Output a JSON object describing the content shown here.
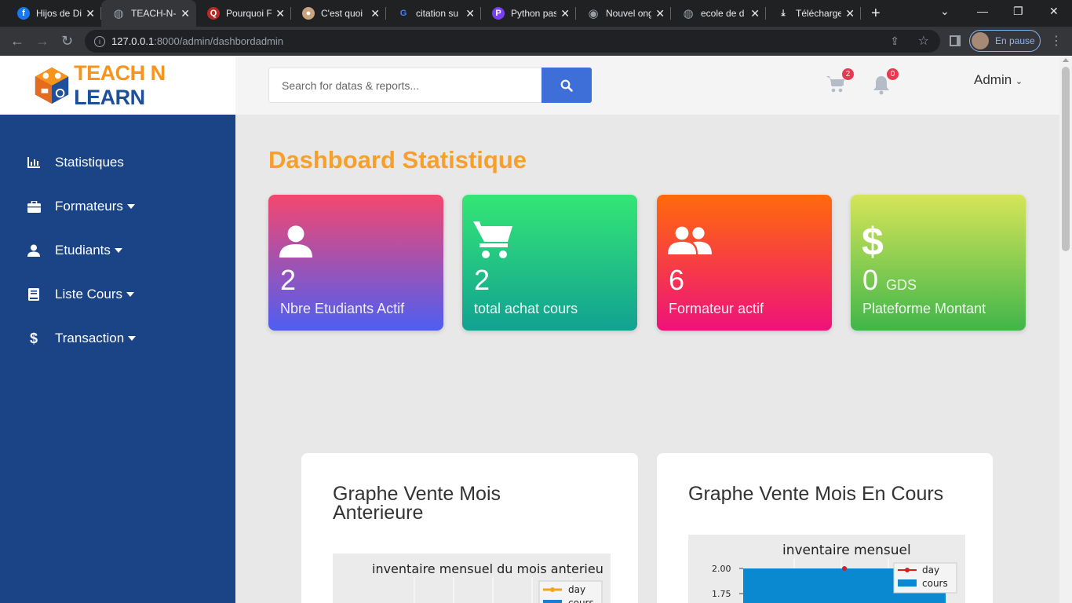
{
  "browser": {
    "tabs": [
      {
        "title": "Hijos de Di",
        "icon": "facebook-icon",
        "color": "#1877f2"
      },
      {
        "title": "TEACH-N-L",
        "icon": "globe-icon",
        "color": "#9aa0a6",
        "active": true
      },
      {
        "title": "Pourquoi F",
        "icon": "quora-icon",
        "color": "#b92b27"
      },
      {
        "title": "C'est quoi",
        "icon": "site-icon",
        "color": "#c9a27e"
      },
      {
        "title": "citation su",
        "icon": "google-icon",
        "color": "#ffffff"
      },
      {
        "title": "Python pas",
        "icon": "pycharm-icon",
        "color": "#7b3ff2"
      },
      {
        "title": "Nouvel ong",
        "icon": "chrome-icon",
        "color": "#9aa0a6"
      },
      {
        "title": "ecole de d",
        "icon": "globe-icon",
        "color": "#9aa0a6"
      },
      {
        "title": "Télécharge",
        "icon": "download-icon",
        "color": "#e8eaed"
      }
    ],
    "url_host": "127.0.0.1",
    "url_rest": ":8000/admin/dashbordadmin",
    "profile_label": "En pause"
  },
  "header": {
    "logo": {
      "part1": "TEACH N ",
      "part2": "LEARN"
    },
    "search_placeholder": "Search for datas & reports...",
    "cart_count": "2",
    "notif_count": "0",
    "user_label": "Admin"
  },
  "sidebar": {
    "items": [
      {
        "label": "Statistiques",
        "icon": "bar-chart-icon",
        "has_caret": false
      },
      {
        "label": "Formateurs",
        "icon": "briefcase-icon",
        "has_caret": true
      },
      {
        "label": "Etudiants",
        "icon": "user-icon",
        "has_caret": true
      },
      {
        "label": "Liste Cours",
        "icon": "book-icon",
        "has_caret": true
      },
      {
        "label": "Transaction",
        "icon": "dollar-icon",
        "has_caret": true
      }
    ]
  },
  "main": {
    "title": "Dashboard Statistique",
    "cards": [
      {
        "value": "2",
        "unit": "",
        "label": "Nbre Etudiants Actif",
        "icon": "user-icon",
        "gradient": [
          "#f4476f",
          "#4e5ef2"
        ]
      },
      {
        "value": "2",
        "unit": "",
        "label": "total achat cours",
        "icon": "cart-icon",
        "gradient": [
          "#34e675",
          "#11a192"
        ]
      },
      {
        "value": "6",
        "unit": "",
        "label": "Formateur actif",
        "icon": "users-icon",
        "gradient": [
          "#ff6a0b",
          "#ee127a"
        ]
      },
      {
        "value": "0",
        "unit": "GDS",
        "label": "Plateforme Montant",
        "icon": "dollar-icon",
        "gradient": [
          "#d6e558",
          "#40b64a"
        ]
      }
    ],
    "panels": [
      {
        "title": "Graphe Vente Mois Anterieure"
      },
      {
        "title": "Graphe Vente Mois En Cours"
      }
    ]
  },
  "chart_data": [
    {
      "type": "line",
      "title": "inventaire mensuel du mois anterieu",
      "legend": [
        "day",
        "cours"
      ],
      "series": [
        {
          "name": "day",
          "color": "#f7a21b"
        },
        {
          "name": "cours",
          "color": "#1a7ed0"
        }
      ]
    },
    {
      "type": "bar",
      "title": "inventaire mensuel",
      "y_ticks": [
        "2.00",
        "1.75"
      ],
      "ylim": [
        1.75,
        2.0
      ],
      "legend_position": "top-right",
      "series": [
        {
          "name": "day",
          "type": "line",
          "color": "#d62020",
          "values": [
            2.0
          ]
        },
        {
          "name": "cours",
          "type": "bar",
          "color": "#0a88d0",
          "values": [
            2.0
          ]
        }
      ]
    }
  ]
}
